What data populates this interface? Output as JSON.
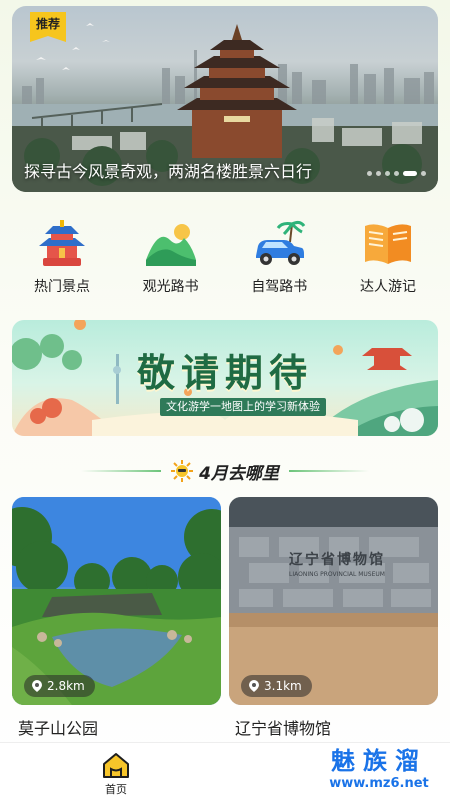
{
  "hero": {
    "tag": "推荐",
    "caption": "探寻古今风景奇观，两湖名楼胜景六日行",
    "slide_count": 6,
    "active_slide": 5
  },
  "quick_nav": [
    {
      "label": "热门景点",
      "icon": "temple-icon"
    },
    {
      "label": "观光路书",
      "icon": "mountain-icon"
    },
    {
      "label": "自驾路书",
      "icon": "car-icon"
    },
    {
      "label": "达人游记",
      "icon": "book-icon"
    }
  ],
  "promo": {
    "title": "敬请期待",
    "subtitle": "文化游学一地图上的学习新体验"
  },
  "section": {
    "title": "4月去哪里"
  },
  "cards": [
    {
      "name": "莫子山公园",
      "distance": "2.8km"
    },
    {
      "name": "辽宁省博物馆",
      "distance": "3.1km"
    }
  ],
  "museum_sign": {
    "cn": "辽宁省博物馆",
    "en": "LIAONING PROVINCIAL MUSEUM"
  },
  "tabbar": {
    "home_label": "首页"
  },
  "watermark": {
    "line1": "魅族溜",
    "line2": "www.mz6.net"
  },
  "colors": {
    "accent_green": "#6cc47a",
    "tag_yellow": "#f6c51d",
    "home_icon": "#f2b705",
    "watermark_blue": "#1a73e8"
  }
}
